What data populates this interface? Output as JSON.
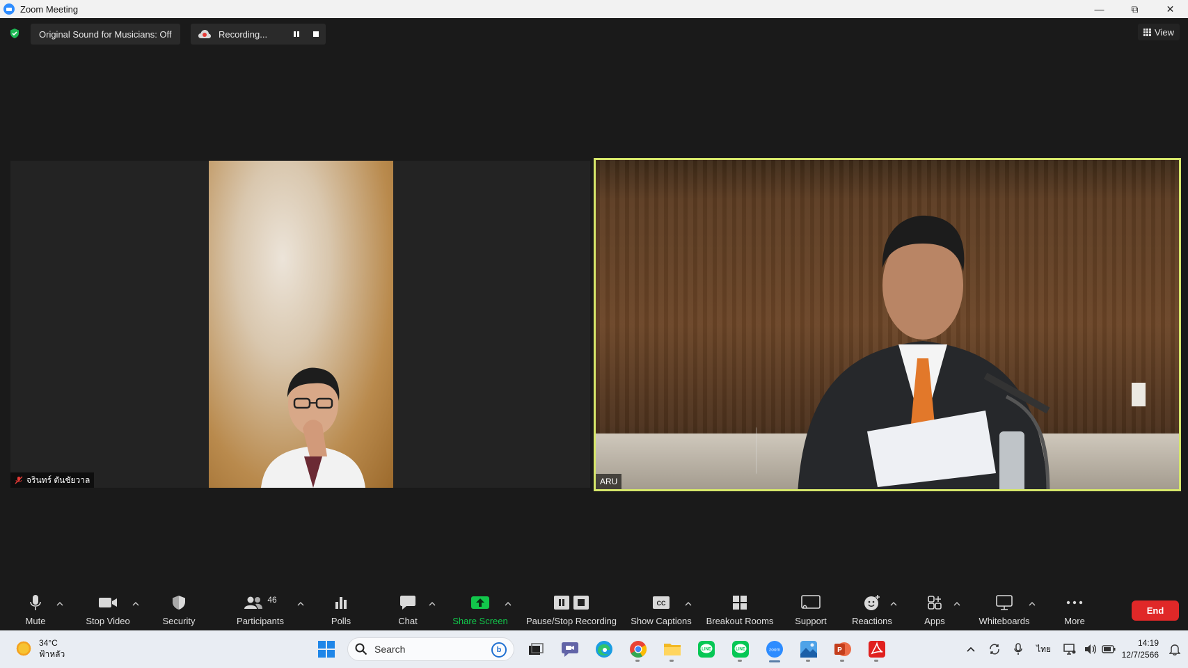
{
  "window": {
    "title": "Zoom Meeting"
  },
  "topbar": {
    "original_sound": "Original Sound for Musicians: Off",
    "recording_label": "Recording...",
    "view_label": "View"
  },
  "participants_video": {
    "left": {
      "name": "จรินทร์ ตันชัยวาล"
    },
    "right": {
      "name": "ARU"
    }
  },
  "toolbar": {
    "mute": "Mute",
    "stop_video": "Stop Video",
    "security": "Security",
    "participants": "Participants",
    "participants_count": "46",
    "polls": "Polls",
    "chat": "Chat",
    "share_screen": "Share Screen",
    "pause_stop_recording": "Pause/Stop Recording",
    "show_captions": "Show Captions",
    "breakout_rooms": "Breakout Rooms",
    "support": "Support",
    "reactions": "Reactions",
    "apps": "Apps",
    "whiteboards": "Whiteboards",
    "more": "More",
    "end": "End"
  },
  "taskbar": {
    "weather_temp": "34°C",
    "weather_desc": "ฟ้าหลัว",
    "search_placeholder": "Search",
    "language": "ไทย",
    "time": "14:19",
    "date": "12/7/2566"
  },
  "colors": {
    "active_speaker_border": "#d6e66a",
    "share_green": "#12c64b",
    "end_red": "#e02828",
    "zoom_blue": "#2d8cff"
  }
}
